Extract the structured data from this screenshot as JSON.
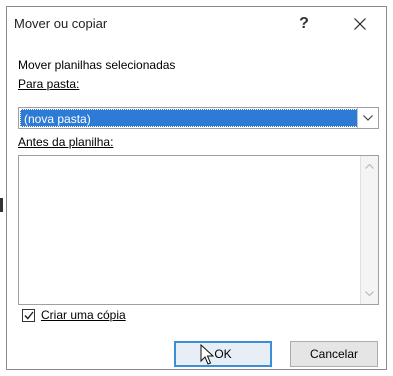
{
  "dialog": {
    "title": "Mover ou copiar",
    "help_label": "?",
    "close_icon": "close-icon"
  },
  "main": {
    "move_label": "Mover planilhas selecionadas",
    "to_book_label": "Para pasta:",
    "to_book_value": "(nova pasta)",
    "before_sheet_label": "Antes da planilha:",
    "before_sheet_items": []
  },
  "options": {
    "create_copy_label": "Criar uma cópia",
    "create_copy_checked": true
  },
  "buttons": {
    "ok_label": "OK",
    "cancel_label": "Cancelar"
  },
  "colors": {
    "selection": "#2e7bd6",
    "focus_border": "#3b8fd9"
  }
}
